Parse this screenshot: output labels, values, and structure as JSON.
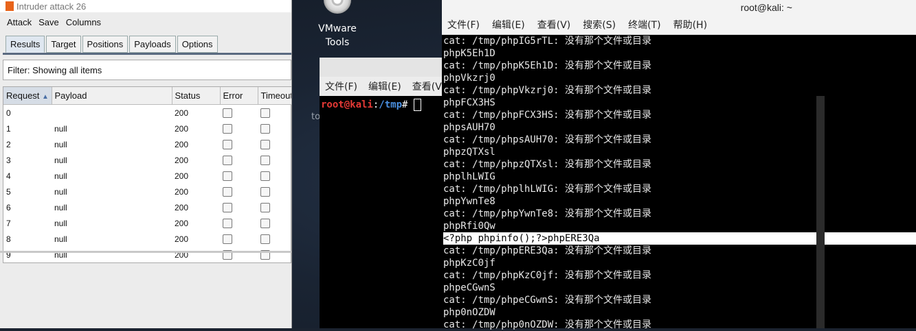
{
  "desktop": {
    "icon_label_line1": "VMware",
    "icon_label_line2": "Tools",
    "folder_label": "tools-distrib"
  },
  "burp": {
    "title": "Intruder attack 26",
    "menu": [
      "Attack",
      "Save",
      "Columns"
    ],
    "tabs": [
      "Results",
      "Target",
      "Positions",
      "Payloads",
      "Options"
    ],
    "filter": "Filter: Showing all items",
    "columns": [
      "Request",
      "Payload",
      "Status",
      "Error",
      "Timeout"
    ],
    "rows": [
      {
        "request": "0",
        "payload": "",
        "status": "200"
      },
      {
        "request": "1",
        "payload": "null",
        "status": "200"
      },
      {
        "request": "2",
        "payload": "null",
        "status": "200"
      },
      {
        "request": "3",
        "payload": "null",
        "status": "200"
      },
      {
        "request": "4",
        "payload": "null",
        "status": "200"
      },
      {
        "request": "5",
        "payload": "null",
        "status": "200"
      },
      {
        "request": "6",
        "payload": "null",
        "status": "200"
      },
      {
        "request": "7",
        "payload": "null",
        "status": "200"
      },
      {
        "request": "8",
        "payload": "null",
        "status": "200"
      },
      {
        "request": "9",
        "payload": "null",
        "status": "200"
      }
    ]
  },
  "term_back": {
    "menu": [
      "文件(F)",
      "编辑(E)",
      "查看(V)"
    ],
    "prompt_user": "root@kali",
    "prompt_sep": ":",
    "prompt_path": "/tmp",
    "prompt_end": "# "
  },
  "term_front": {
    "title": "root@kali: ~",
    "menu": [
      "文件(F)",
      "编辑(E)",
      "查看(V)",
      "搜索(S)",
      "终端(T)",
      "帮助(H)"
    ],
    "lines": [
      "cat: /tmp/phpIG5rTL: 没有那个文件或目录",
      "phpK5Eh1D",
      "cat: /tmp/phpK5Eh1D: 没有那个文件或目录",
      "phpVkzrj0",
      "cat: /tmp/phpVkzrj0: 没有那个文件或目录",
      "phpFCX3HS",
      "cat: /tmp/phpFCX3HS: 没有那个文件或目录",
      "phpsAUH70",
      "cat: /tmp/phpsAUH70: 没有那个文件或目录",
      "phpzQTXsl",
      "cat: /tmp/phpzQTXsl: 没有那个文件或目录",
      "phplhLWIG",
      "cat: /tmp/phplhLWIG: 没有那个文件或目录",
      "phpYwnTe8",
      "cat: /tmp/phpYwnTe8: 没有那个文件或目录",
      "phpRfi0Qw",
      "<?php phpinfo();?>phpERE3Qa",
      "cat: /tmp/phpERE3Qa: 没有那个文件或目录",
      "phpKzC0jf",
      "cat: /tmp/phpKzC0jf: 没有那个文件或目录",
      "phpeCGwnS",
      "cat: /tmp/phpeCGwnS: 没有那个文件或目录",
      "php0nOZDW",
      "cat: /tmp/php0nOZDW: 没有那个文件或目录"
    ],
    "highlight_index": 16
  }
}
